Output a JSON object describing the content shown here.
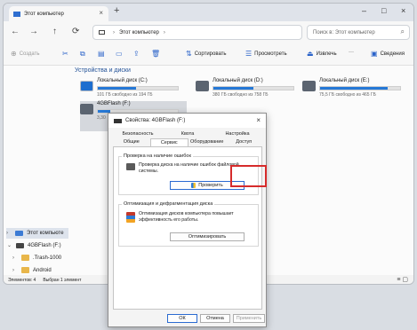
{
  "window": {
    "tab_title": "Этот компьютер",
    "tab_close": "×",
    "tab_new": "+",
    "controls": [
      "–",
      "□",
      "×"
    ]
  },
  "navbar": {
    "back": "←",
    "forward": "→",
    "up": "↑",
    "refresh": "⟳",
    "address": [
      "Этот компьютер",
      "›"
    ],
    "search_placeholder": "Поиск в: Этот компьютер",
    "search_icon": "⌕"
  },
  "toolbar": {
    "create": "Создать",
    "sort": "Сортировать",
    "view": "Просмотреть",
    "eject": "Извлечь",
    "more": "···",
    "details": "Сведения"
  },
  "content": {
    "section_title": "Устройства и диски",
    "drives": [
      {
        "name": "Локальный диск (C:)",
        "free": "101 ГБ свободно из 194 ГБ",
        "used_pct": 48,
        "icon": "windows-drive-icon"
      },
      {
        "name": "Локальный диск (D:)",
        "free": "380 ГБ свободно из 758 ГБ",
        "used_pct": 50,
        "icon": "drive-icon"
      },
      {
        "name": "Локальный диск (E:)",
        "free": "75,5 ГБ свободно из 465 ГБ",
        "used_pct": 84,
        "icon": "drive-icon"
      },
      {
        "name": "4GBFlash (F:)",
        "free": "3,30",
        "used_pct": 15,
        "icon": "usb-drive-icon"
      }
    ]
  },
  "sidebar": {
    "items": [
      {
        "label": "Этот компьюте",
        "chev": "›"
      },
      {
        "label": "4GBFlash (F:)",
        "chev": "⌄"
      },
      {
        "label": ".Trash-1000",
        "chev": "›"
      },
      {
        "label": "Android",
        "chev": "›"
      }
    ]
  },
  "statusbar": {
    "count": "Элементов: 4",
    "selected": "Выбран 1 элемент",
    "view_icons": "≡ ▢"
  },
  "dialog": {
    "title": "Свойства: 4GBFlash (F:)",
    "close": "×",
    "tabs_row1": [
      "Безопасность",
      "Квота",
      "Настройка"
    ],
    "tabs_row2": [
      "Общие",
      "Сервис",
      "Оборудование",
      "Доступ"
    ],
    "active_tab": "Сервис",
    "check": {
      "title": "Проверка на наличие ошибок",
      "text": "Проверка диска на наличие ошибок файловой системы.",
      "button": "Проверить"
    },
    "optimize": {
      "title": "Оптимизация и дефрагментация диска",
      "text": "Оптимизация дисков компьютера повышает эффективность его работы.",
      "button": "Оптимизировать"
    },
    "buttons": {
      "ok": "ОК",
      "cancel": "Отмена",
      "apply": "Применить"
    }
  },
  "colors": {
    "accent": "#2678d6",
    "highlight": "#d62b2b",
    "folder": "#e8b64a"
  }
}
